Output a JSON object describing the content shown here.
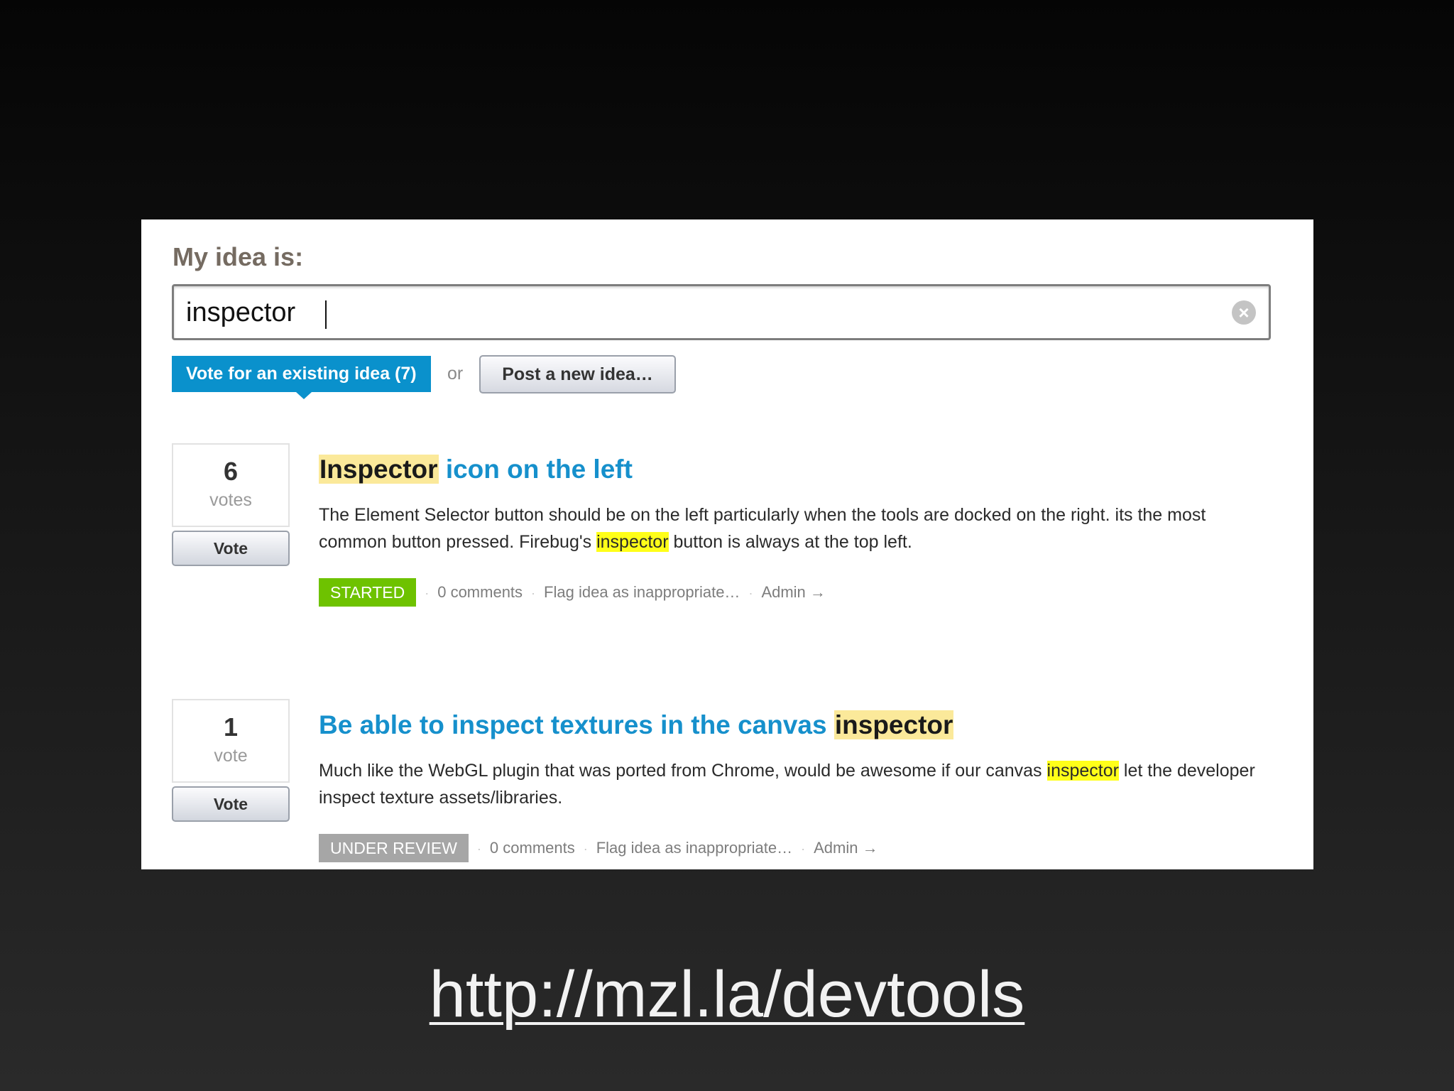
{
  "composer": {
    "label": "My idea is:",
    "query": "inspector",
    "vote_tab_label": "Vote for an existing idea (7)",
    "or_label": "or",
    "post_button_label": "Post a new idea…"
  },
  "ideas": [
    {
      "votes": "6",
      "votes_unit": "votes",
      "vote_button": "Vote",
      "title_highlight": "Inspector",
      "title_rest": " icon on the left",
      "desc_before": "The Element Selector button should be on the left particularly when the tools are docked on the right. its the most common button pressed. Firebug's ",
      "desc_highlight": "inspector",
      "desc_after": " button is always at the top left.",
      "status": "STARTED",
      "comments": "0 comments",
      "flag": "Flag idea as inappropriate…",
      "admin": "Admin →"
    },
    {
      "votes": "1",
      "votes_unit": "vote",
      "vote_button": "Vote",
      "title_rest": "Be able to inspect textures in the canvas ",
      "title_highlight": "inspector",
      "desc_before": "Much like the WebGL plugin that was ported from Chrome, would be awesome if our canvas ",
      "desc_highlight": "inspector",
      "desc_after": " let the developer inspect texture assets/libraries.",
      "status": "UNDER REVIEW",
      "comments": "0 comments",
      "flag": "Flag idea as inappropriate…",
      "admin": "Admin →"
    }
  ],
  "footer": {
    "url_text": "http://mzl.la/devtools"
  },
  "colors": {
    "accent_blue": "#0a91cc",
    "started_green": "#6ec200",
    "review_gray": "#a6a6a6",
    "highlight_yellow": "#ffff19",
    "title_highlight": "#fbe99a"
  }
}
